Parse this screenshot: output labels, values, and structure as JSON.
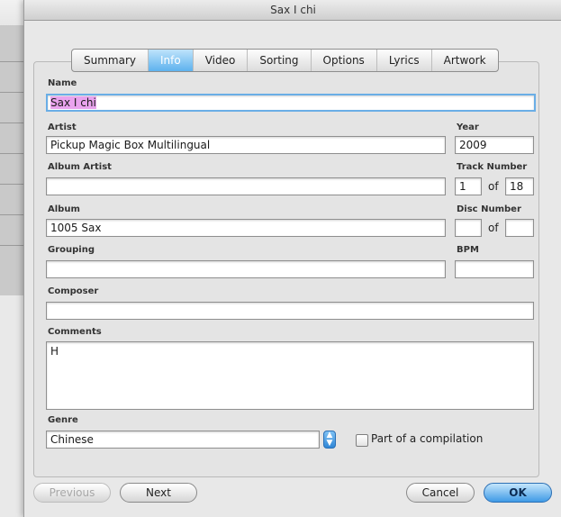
{
  "window": {
    "title": "Sax I chi"
  },
  "tabs": [
    {
      "label": "Summary",
      "active": false
    },
    {
      "label": "Info",
      "active": true
    },
    {
      "label": "Video",
      "active": false
    },
    {
      "label": "Sorting",
      "active": false
    },
    {
      "label": "Options",
      "active": false
    },
    {
      "label": "Lyrics",
      "active": false
    },
    {
      "label": "Artwork",
      "active": false
    }
  ],
  "fields": {
    "name": {
      "label": "Name",
      "value": "Sax I chi"
    },
    "artist": {
      "label": "Artist",
      "value": "Pickup Magic Box Multilingual"
    },
    "year": {
      "label": "Year",
      "value": "2009"
    },
    "album_artist": {
      "label": "Album Artist",
      "value": ""
    },
    "track_number": {
      "label": "Track Number",
      "value": "1",
      "of_label": "of",
      "total": "18"
    },
    "album": {
      "label": "Album",
      "value": "1005 Sax"
    },
    "disc_number": {
      "label": "Disc Number",
      "value": "",
      "of_label": "of",
      "total": ""
    },
    "grouping": {
      "label": "Grouping",
      "value": ""
    },
    "bpm": {
      "label": "BPM",
      "value": ""
    },
    "composer": {
      "label": "Composer",
      "value": ""
    },
    "comments": {
      "label": "Comments",
      "value": "H"
    },
    "genre": {
      "label": "Genre",
      "value": "Chinese"
    }
  },
  "compilation": {
    "label": "Part of a compilation",
    "checked": false
  },
  "buttons": {
    "previous": "Previous",
    "next": "Next",
    "cancel": "Cancel",
    "ok": "OK"
  },
  "icons": {
    "popup": "up-down-arrows-icon"
  },
  "colors": {
    "accent": "#5eb2ee",
    "selection": "#e9a3ee"
  }
}
